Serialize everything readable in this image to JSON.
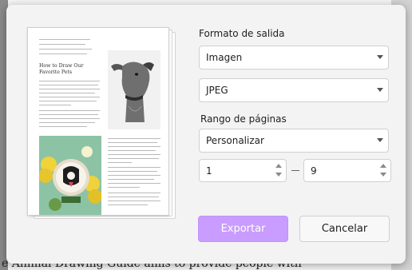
{
  "background": {
    "text": "e Animal Drawing Guide aims to provide people with"
  },
  "preview": {
    "title": "How to Draw Our Favorite Pets"
  },
  "form": {
    "output_format_label": "Formato de salida",
    "output_format_value": "Imagen",
    "image_type_value": "JPEG",
    "page_range_label": "Rango de páginas",
    "page_range_value": "Personalizar",
    "range_from": "1",
    "range_to": "9",
    "range_separator": "—"
  },
  "buttons": {
    "export_label": "Exportar",
    "cancel_label": "Cancelar"
  },
  "colors": {
    "accent": "#c99cff",
    "dialog_bg": "#f3f3f3"
  }
}
